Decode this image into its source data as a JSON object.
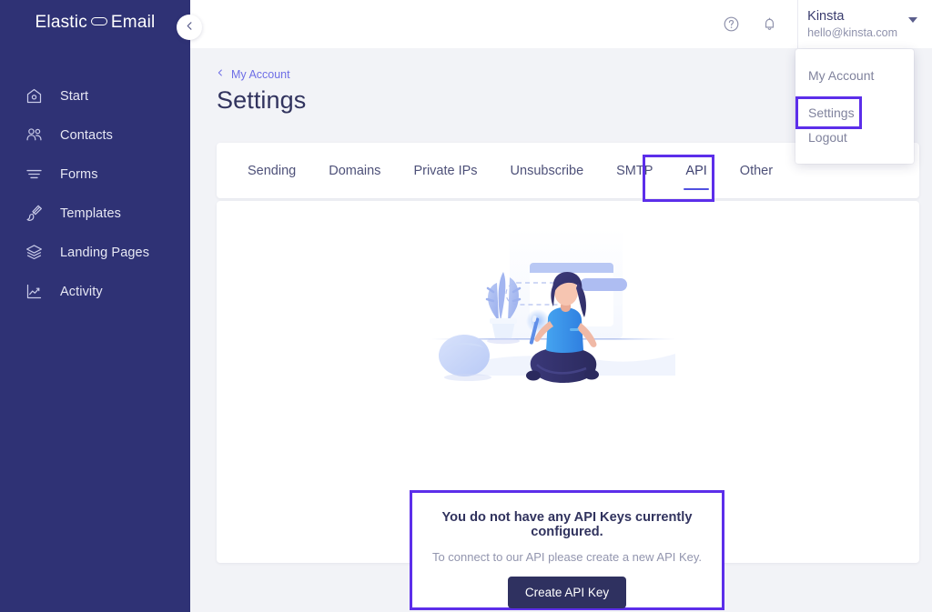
{
  "brand": {
    "logo_left": "Elastic",
    "logo_right": "Email",
    "sidebar_bg": "#2f3275",
    "accent": "#5c2eea",
    "tab_underline": "#5050e0"
  },
  "sidebar": {
    "items": [
      {
        "label": "Start",
        "icon": "home-icon"
      },
      {
        "label": "Contacts",
        "icon": "people-icon"
      },
      {
        "label": "Forms",
        "icon": "form-lines-icon"
      },
      {
        "label": "Templates",
        "icon": "brush-icon"
      },
      {
        "label": "Landing Pages",
        "icon": "layers-icon"
      },
      {
        "label": "Activity",
        "icon": "chart-line-icon"
      }
    ],
    "collapse_icon": "chevron-left-icon"
  },
  "header": {
    "help_icon": "help-circle-icon",
    "bell_icon": "bell-icon",
    "user_name": "Kinsta",
    "user_email": "hello@kinsta.com",
    "caret_icon": "caret-down-icon"
  },
  "dropdown": {
    "items": [
      {
        "label": "My Account"
      },
      {
        "label": "Settings",
        "highlighted": true
      },
      {
        "label": "Logout"
      }
    ]
  },
  "page": {
    "breadcrumb_label": "My Account",
    "breadcrumb_icon": "chevron-left-icon",
    "title": "Settings"
  },
  "tabs": [
    {
      "label": "Sending",
      "active": false
    },
    {
      "label": "Domains",
      "active": false
    },
    {
      "label": "Private IPs",
      "active": false
    },
    {
      "label": "Unsubscribe",
      "active": false
    },
    {
      "label": "SMTP",
      "active": false
    },
    {
      "label": "API",
      "active": true,
      "highlighted": true
    },
    {
      "label": "Other",
      "active": false
    }
  ],
  "empty_state": {
    "illustration": "person-with-wand-illustration",
    "title": "You do not have any API Keys currently configured.",
    "subtitle": "To connect to our API please create a new API Key.",
    "button_label": "Create API Key"
  }
}
